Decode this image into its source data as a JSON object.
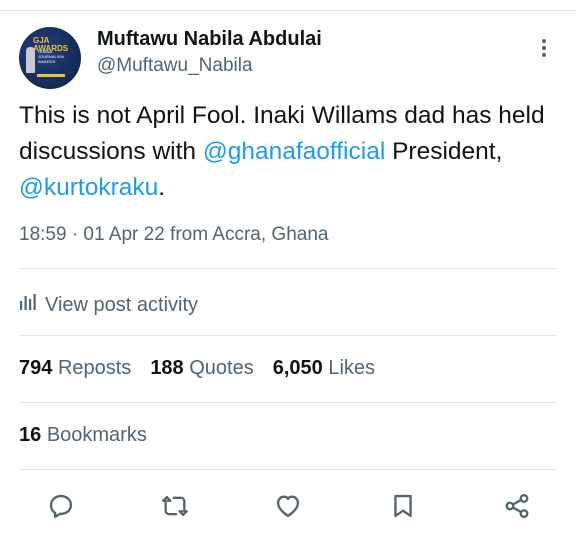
{
  "author": {
    "name": "Muftawu Nabila Abdulai",
    "handle": "@Muftawu_Nabila",
    "avatar_title": "GJA AWARDS",
    "avatar_text": "GHANA JOURNALISM AWARDS"
  },
  "post": {
    "text_before": "This is not April Fool. Inaki Willams dad has held discussions with ",
    "mention_1": "@ghanafaofficial",
    "text_middle": " President, ",
    "mention_2": "@kurtokraku",
    "text_after": ".",
    "meta": "18:59 · 01 Apr 22 from Accra, Ghana"
  },
  "activity": {
    "label": "View post activity",
    "icon": "analytics-icon"
  },
  "stats": {
    "reposts_count": "794",
    "reposts_label": "Reposts",
    "quotes_count": "188",
    "quotes_label": "Quotes",
    "likes_count": "6,050",
    "likes_label": "Likes",
    "bookmarks_count": "16",
    "bookmarks_label": "Bookmarks"
  },
  "actions": [
    "reply-icon",
    "repost-icon",
    "like-icon",
    "bookmark-icon",
    "share-icon"
  ],
  "colors": {
    "text": "#0f1419",
    "secondary": "#536471",
    "link": "#1d9bf0",
    "divider": "#e7e9ea"
  }
}
